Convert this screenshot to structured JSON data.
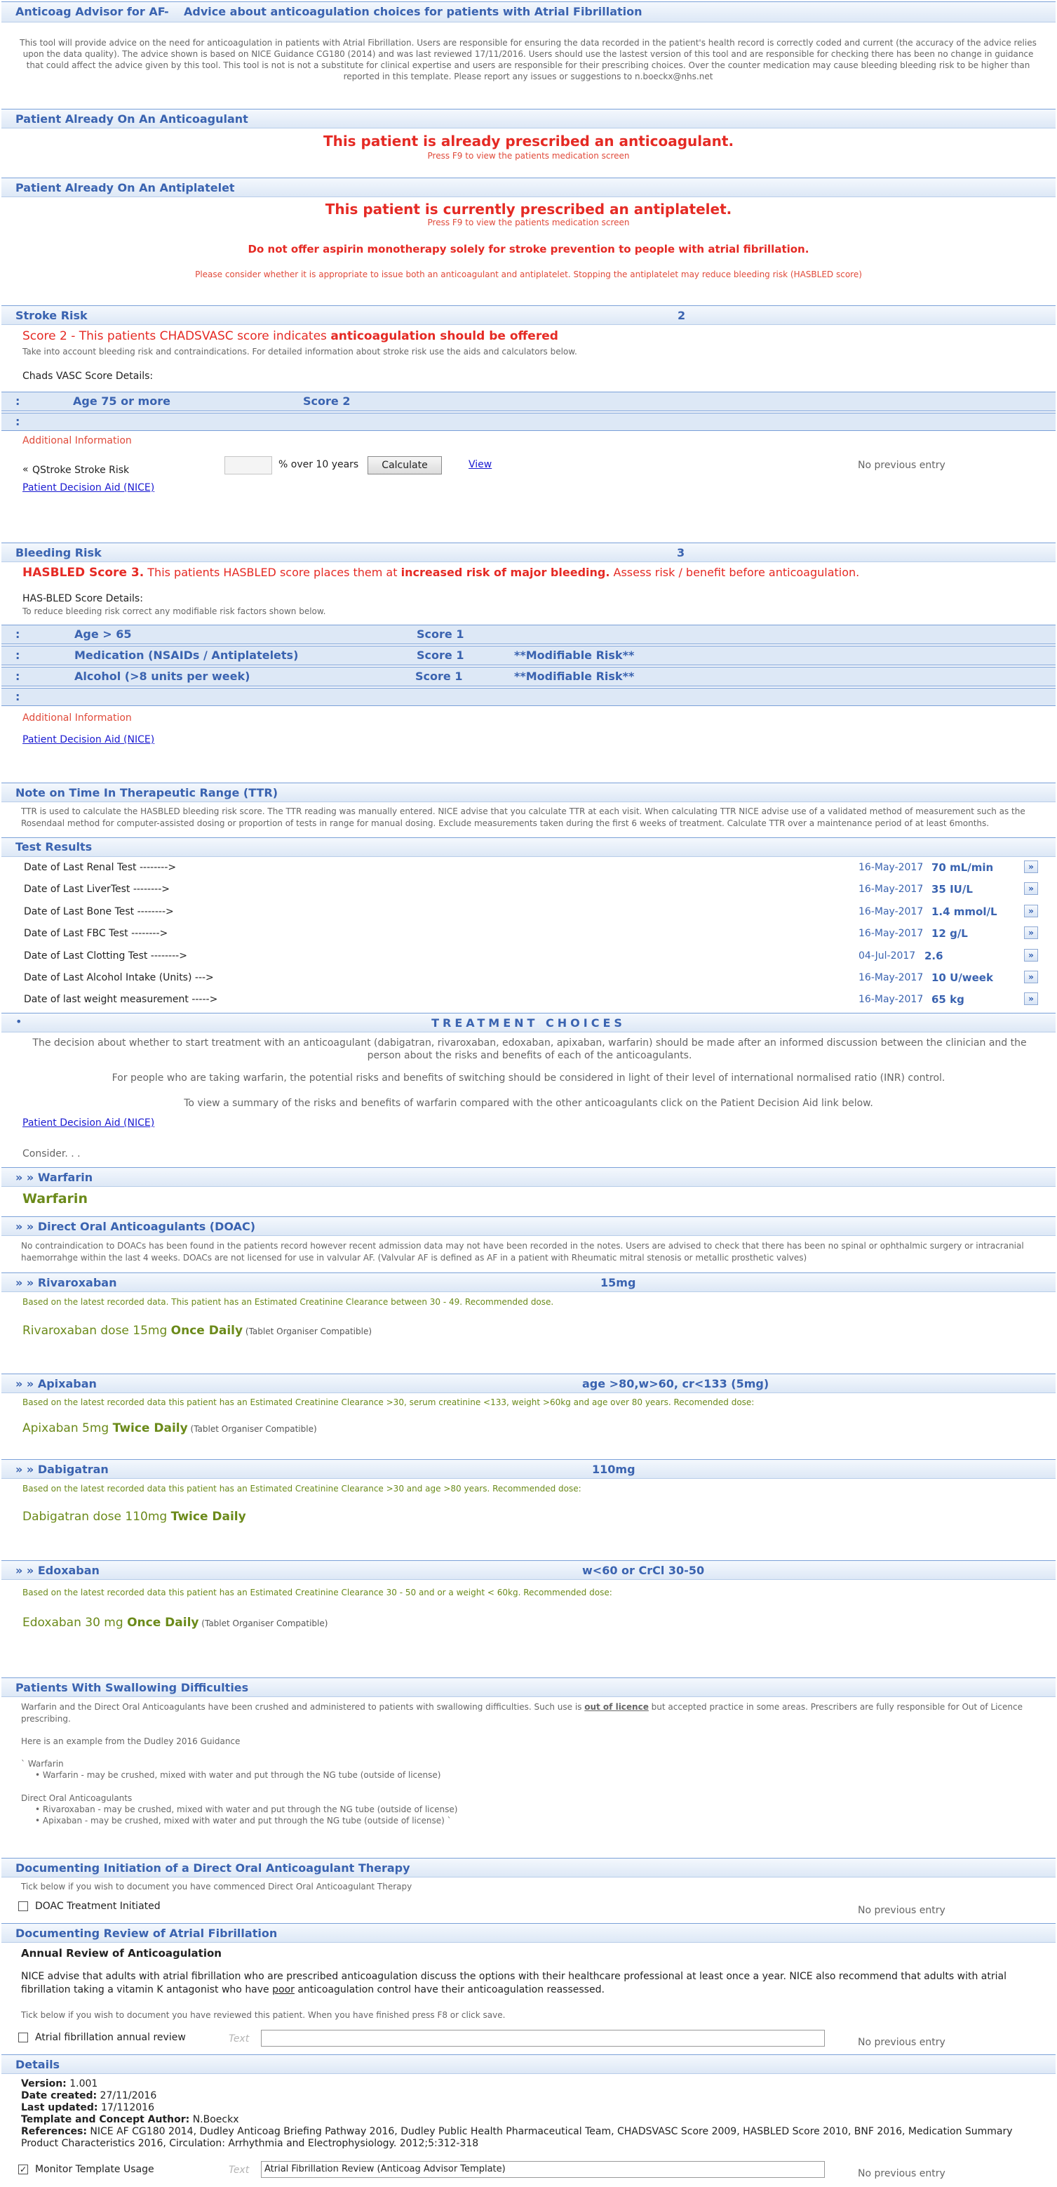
{
  "header": {
    "title": "Anticoag Advisor for AF",
    "separator": "-",
    "subtitle": "Advice about anticoagulation choices for patients with Atrial Fibrillation",
    "disclaimer": "This tool will provide advice on the need for anticoagulation in patients with Atrial Fibrillation. Users are responsible for ensuring the data recorded in the patient's health record is correctly coded and current (the accuracy of the advice relies upon the data quality).  The advice shown is based on NICE Guidance CG180 (2014) and was last reviewed 17/11/2016.  Users should use the lastest version of this tool and are responsible for checking there has been no change in guidance that could affect the advice given by this tool. This tool is not is not a substitute for clinical expertise and users are responsible for their prescribing choices. Over the counter medication may cause bleeding bleeding risk to be higher than reported in this template. Please report any issues or suggestions to n.boeckx@nhs.net"
  },
  "anticoagulant": {
    "title": "Patient Already On An Anticoagulant",
    "message": "This patient is already prescribed an anticoagulant.",
    "hint": "Press F9 to view the patients medication screen"
  },
  "antiplatelet": {
    "title": "Patient Already On An Antiplatelet",
    "message": "This patient is currently prescribed an antiplatelet.",
    "hint": "Press F9 to view the patients medication screen",
    "warning": "Do not offer aspirin monotherapy solely for stroke prevention to people with atrial fibrillation.",
    "note": "Please consider whether it is appropriate to issue both an anticoagulant and antiplatelet. Stopping the antiplatelet may reduce bleeding risk (HASBLED score)"
  },
  "stroke": {
    "title": "Stroke Risk",
    "score": "2",
    "line_a": "Score 2 - This patients CHADSVASC score indicates ",
    "line_b": "anticoagulation should be offered",
    "info": "Take into account bleeding risk and contraindications. For detailed information about stroke risk use the aids and calculators below.",
    "details_label": "Chads VASC Score Details:",
    "row1_colon": ":",
    "row1_label": "Age 75 or more",
    "row1_score": "Score 2",
    "row2_colon": ":",
    "additional": "Additional Information",
    "qstroke_label": "QStroke Stroke Risk",
    "qstroke_icon": "chevron-left-double",
    "percent_label": "% over 10 years",
    "calculate": "Calculate",
    "view": "View",
    "no_entry": "No previous entry",
    "decision_aid": "Patient Decision Aid (NICE)"
  },
  "bleeding": {
    "title": "Bleeding Risk",
    "score": "3",
    "line_a": "HASBLED Score 3.",
    "line_b": " This patients HASBLED score places them at ",
    "line_c": "increased risk of major bleeding.",
    "line_d": " Assess risk / benefit before anticoagulation.",
    "details_label": "HAS-BLED Score Details:",
    "details_sub": "To reduce bleeding risk correct any modifiable risk factors shown below.",
    "rows": [
      {
        "colon": ":",
        "label": "Age > 65",
        "score": "Score 1",
        "flag": ""
      },
      {
        "colon": ":",
        "label": "Medication (NSAIDs / Antiplatelets)",
        "score": "Score 1",
        "flag": "**Modifiable Risk**"
      },
      {
        "colon": ":",
        "label": "Alcohol (>8 units per week)",
        "score": "Score 1",
        "flag": "**Modifiable Risk**"
      }
    ],
    "row4_colon": ":",
    "additional": "Additional Information",
    "decision_aid": "Patient Decision Aid (NICE)"
  },
  "ttr": {
    "title": "Note on Time In Therapeutic Range (TTR)",
    "text": "TTR is used to calculate the HASBLED bleeding risk score. The TTR reading was manually entered. NICE advise that you calculate TTR at each visit.  When calculating TTR NICE advise use of a validated method of measurement such as the Rosendaal method for computer-assisted dosing or proportion of tests in range for manual dosing. Exclude measurements taken during the first 6 weeks of treatment. Calculate TTR over a maintenance period of at least 6months."
  },
  "tests": {
    "title": "Test Results",
    "rows": [
      {
        "label": "Date of Last Renal Test -------->",
        "date": "16-May-2017",
        "value": "70 mL/min"
      },
      {
        "label": "Date of Last LiverTest -------->",
        "date": "16-May-2017",
        "value": "35 IU/L"
      },
      {
        "label": "Date of Last Bone Test -------->",
        "date": "16-May-2017",
        "value": "1.4 mmol/L"
      },
      {
        "label": "Date of Last FBC Test -------->",
        "date": "16-May-2017",
        "value": "12 g/L"
      },
      {
        "label": "Date of Last Clotting Test -------->",
        "date": "04-Jul-2017",
        "value": "2.6"
      },
      {
        "label": "Date of Last Alcohol Intake (Units) --->",
        "date": "16-May-2017",
        "value": "10 U/week"
      },
      {
        "label": "Date of last weight measurement ----->",
        "date": "16-May-2017",
        "value": "65 kg"
      }
    ],
    "go": "»"
  },
  "treatment": {
    "bullet": "•",
    "title": "TREATMENT CHOICES",
    "p1": "The decision about whether to start treatment with an anticoagulant  (dabigatran, rivaroxaban, edoxaban, apixaban, warfarin) should be made after an informed discussion between the clinician and the person about the risks and benefits of each of the anticoagulants.",
    "p2": "For people who are taking warfarin, the potential risks and benefits of switching should be considered in light of their level of international normalised ratio (INR) control.",
    "p3": "To view a summary of the risks and benefits of warfarin compared with the other anticoagulants click on the Patient Decision Aid link below.",
    "decision_aid": "Patient Decision Aid (NICE)",
    "consider": "Consider. . ."
  },
  "warfarin": {
    "title": "» » Warfarin",
    "name": "Warfarin"
  },
  "doac": {
    "title": "» » Direct Oral Anticoagulants (DOAC)",
    "text": "No contraindication to DOACs has been found in the patients record however recent admission data may not have been recorded in the notes. Users are advised to check that there has been no spinal or ophthalmic surgery or intracranial haemorrahge within the last 4 weeks. DOACs are not licensed for use in valvular AF. (Valvular AF is defined as AF in a patient with Rheumatic mitral stenosis or metallic prosthetic valves)"
  },
  "drugs": [
    {
      "title": "» » Rivaroxaban",
      "dose": "15mg",
      "basis": "Based on the latest recorded data. This patient has an Estimated Creatinine Clearance between 30 - 49. Recommended dose.",
      "text": "Rivaroxaban dose 15mg ",
      "freq": "Once Daily",
      "note": " (Tablet Organiser Compatible)"
    },
    {
      "title": "» » Apixaban",
      "dose": "age >80,w>60, cr<133 (5mg)",
      "basis": "Based on the latest recorded data this patient has an Estimated Creatinine Clearance >30, serum creatinine <133, weight >60kg and age over 80 years. Recomended dose:",
      "text": "Apixaban 5mg ",
      "freq": "Twice Daily",
      "note": " (Tablet Organiser Compatible)"
    },
    {
      "title": "» » Dabigatran",
      "dose": "110mg",
      "basis": "Based on the latest recorded data this patient has an Estimated Creatinine Clearance >30 and age >80 years. Recommended dose:",
      "text": "Dabigatran dose 110mg ",
      "freq": "Twice Daily",
      "note": ""
    },
    {
      "title": "» » Edoxaban",
      "dose": "w<60 or CrCl 30-50",
      "basis": "Based on the latest recorded data this patient has an  Estimated Creatinine Clearance 30 - 50 and or a weight < 60kg. Recommended dose:",
      "text": "Edoxaban 30 mg ",
      "freq": "Once Daily",
      "note": " (Tablet Organiser Compatible)"
    }
  ],
  "swallow": {
    "title": "Patients With Swallowing Difficulties",
    "p1a": "Warfarin and the Direct Oral Anticoagulants have been crushed and administered to patients with swallowing difficulties. Such use is ",
    "p1b": "out of licence",
    "p1c": " but accepted practice in some areas. Prescribers are fully responsible for Out of Licence prescribing.",
    "example": "Here is an example from the Dudley 2016 Guidance",
    "warfarin_head": "` Warfarin",
    "warfarin_item": "•  Warfarin - may be crushed, mixed with water and put through the NG tube (outside of license)",
    "doac_head": "Direct Oral Anticoagulants",
    "doac_item1": "•  Rivaroxaban - may be crushed, mixed with water and put through the NG tube (outside of license)",
    "doac_item2": "•  Apixaban - may be crushed, mixed with water and put through the NG tube (outside of license)  `"
  },
  "doc_init": {
    "title": "Documenting Initiation of a Direct Oral Anticoagulant Therapy",
    "hint": "Tick below if you wish to document you have commenced Direct Oral Anticoagulant Therapy",
    "checkbox": "DOAC Treatment Initiated",
    "no_entry": "No previous entry"
  },
  "doc_review": {
    "title": "Documenting Review of Atrial Fibrillation",
    "heading": "Annual Review of Anticoagulation",
    "p1a": "NICE advise that adults with atrial fibrillation who are prescribed anticoagulation discuss the options with their healthcare professional at least once a year. NICE also recommend that adults with atrial fibrillation taking a vitamin K antagonist who have ",
    "p1b": "poor",
    "p1c": " anticoagulation control have their anticoagulation reassessed.",
    "hint": "Tick below if you wish to document you have reviewed this patient. When you have finished press F8 or click save.",
    "checkbox": "Atrial fibrillation annual review",
    "text_label": "Text",
    "text_value": "",
    "no_entry": "No previous entry"
  },
  "details": {
    "title": "Details",
    "version_label": "Version:",
    "version": " 1.001",
    "created_label": "Date created:",
    "created": " 27/11/2016",
    "updated_label": "Last updated:",
    "updated": " 17/112016",
    "author_label": "Template and Concept Author:",
    "author": " N.Boeckx",
    "refs_label": "References:",
    "refs": "  NICE AF CG180 2014, Dudley Anticoag Briefing Pathway 2016, Dudley Public Health Pharmaceutical Team, CHADSVASC Score 2009, HASBLED Score 2010, BNF 2016, Medication Summary Product Characteristics 2016, Circulation: Arrhythmia and Electrophysiology. 2012;5:312-318",
    "monitor_label": "Monitor Template Usage",
    "monitor_checked": "✓",
    "text_label": "Text",
    "text_value": "Atrial Fibrillation Review (Anticoag Advisor Template)",
    "no_entry": "No previous entry"
  }
}
